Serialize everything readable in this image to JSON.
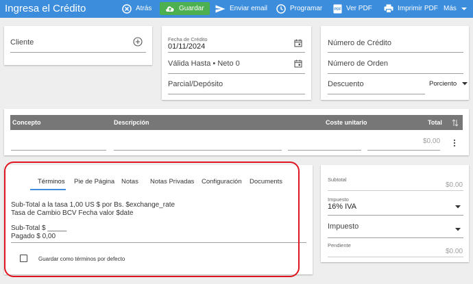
{
  "header": {
    "title": "Ingresa el Crédito",
    "back_label": "Atrás",
    "save_label": "Guardar",
    "email_label": "Enviar email",
    "schedule_label": "Programar",
    "pdf_label": "Ver PDF",
    "print_label": "Imprimir PDF",
    "more_label": "Más"
  },
  "client_card": {
    "client_label": "Cliente"
  },
  "dates_card": {
    "credit_date_label": "Fecha de Crédito",
    "credit_date_value": "01/11/2024",
    "valid_until_label": "Válida Hasta • Neto 0",
    "partial_label": "Parcial/Depósito"
  },
  "numbers_card": {
    "credit_number_label": "Número de Crédito",
    "order_number_label": "Número de Orden",
    "discount_label": "Descuento",
    "discount_type": "Porciento"
  },
  "items_table": {
    "columns": [
      "Concepto",
      "Descripción",
      "Coste unitario",
      "Total"
    ],
    "row_total": "$0.00"
  },
  "terms_card": {
    "tabs": [
      "Términos",
      "Pie de Página",
      "Notas",
      "Notas Privadas",
      "Configuración",
      "Documents"
    ],
    "active_tab": "Términos",
    "line1": "Sub-Total a la tasa 1,00 US $ por Bs. $exchange_rate",
    "line2": "Tasa de Cambio BCV Fecha valor $date",
    "line3": "Sub-Total $ _____",
    "line4": "Pagado $ 0,00",
    "save_default_label": "Guardar como términos por defecto"
  },
  "totals_card": {
    "subtotal_label": "Subtotal",
    "subtotal_value": "$0.00",
    "tax1_label": "Impuesto",
    "tax1_value": "16% IVA",
    "tax2_label": "Impuesto",
    "pending_label": "Pendiente",
    "pending_value": "$0.00"
  },
  "colors": {
    "header_bg": "#3c8ddc",
    "save_button": "#4caf50",
    "table_header": "#777777",
    "annotation": "#e0141e"
  }
}
